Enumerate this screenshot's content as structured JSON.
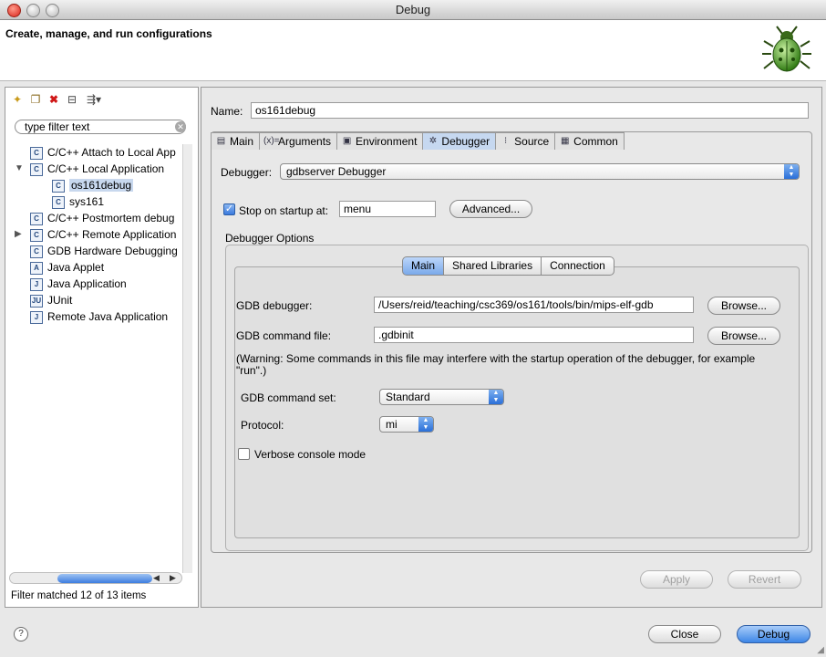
{
  "window": {
    "title": "Debug"
  },
  "header": {
    "text": "Create, manage, and run configurations",
    "logo_icon": "bug-icon"
  },
  "left": {
    "filter_placeholder": "type filter text",
    "tree": [
      {
        "label": "C/C++ Attach to Local App",
        "icon": "C",
        "indent": 0,
        "twisty": ""
      },
      {
        "label": "C/C++ Local Application",
        "icon": "C",
        "indent": 0,
        "twisty": "▼"
      },
      {
        "label": "os161debug",
        "icon": "C",
        "indent": 1,
        "twisty": "",
        "selected": true
      },
      {
        "label": "sys161",
        "icon": "C",
        "indent": 1,
        "twisty": ""
      },
      {
        "label": "C/C++ Postmortem debug",
        "icon": "C",
        "indent": 0,
        "twisty": ""
      },
      {
        "label": "C/C++ Remote Application",
        "icon": "C",
        "indent": 0,
        "twisty": "▶"
      },
      {
        "label": "GDB Hardware Debugging",
        "icon": "C",
        "indent": 0,
        "twisty": ""
      },
      {
        "label": "Java Applet",
        "icon": "A",
        "indent": 0,
        "twisty": ""
      },
      {
        "label": "Java Application",
        "icon": "J",
        "indent": 0,
        "twisty": ""
      },
      {
        "label": "JUnit",
        "icon": "JU",
        "indent": 0,
        "twisty": ""
      },
      {
        "label": "Remote Java Application",
        "icon": "J",
        "indent": 0,
        "twisty": ""
      }
    ],
    "status": "Filter matched 12 of 13 items"
  },
  "right": {
    "name_label": "Name:",
    "name_value": "os161debug",
    "tabs": [
      {
        "label": "Main",
        "icon": "▤",
        "active": false
      },
      {
        "label": "Arguments",
        "icon": "(x)=",
        "active": false
      },
      {
        "label": "Environment",
        "icon": "▣",
        "active": false
      },
      {
        "label": "Debugger",
        "icon": "✲",
        "active": true
      },
      {
        "label": "Source",
        "icon": "⁝",
        "active": false
      },
      {
        "label": "Common",
        "icon": "▦",
        "active": false
      }
    ],
    "debugger_label": "Debugger:",
    "debugger_value": "gdbserver Debugger",
    "stop_label": "Stop on startup at:",
    "stop_checked": true,
    "stop_value": "menu",
    "advanced_button": "Advanced...",
    "options_title": "Debugger Options",
    "subtabs": [
      "Main",
      "Shared Libraries",
      "Connection"
    ],
    "gdb_debugger_label": "GDB debugger:",
    "gdb_debugger_value": "/Users/reid/teaching/csc369/os161/tools/bin/mips-elf-gdb",
    "browse1": "Browse...",
    "gdb_cmdfile_label": "GDB command file:",
    "gdb_cmdfile_value": ".gdbinit",
    "browse2": "Browse...",
    "warning": "(Warning: Some commands in this file may interfere with the startup operation of the debugger, for example \"run\".)",
    "cmdset_label": "GDB command set:",
    "cmdset_value": "Standard",
    "protocol_label": "Protocol:",
    "protocol_value": "mi",
    "verbose_label": "Verbose console mode",
    "verbose_checked": false,
    "apply_button": "Apply",
    "revert_button": "Revert"
  },
  "footer": {
    "help_icon": "help-icon",
    "close_button": "Close",
    "debug_button": "Debug"
  }
}
